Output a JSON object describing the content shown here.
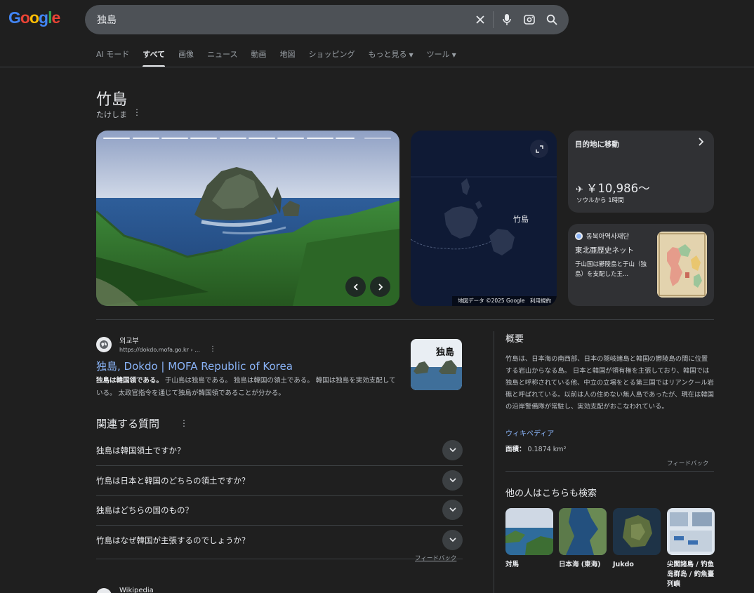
{
  "logo": {
    "text": "Google"
  },
  "search": {
    "query": "独島"
  },
  "tabs": [
    {
      "label": "AI モード"
    },
    {
      "label": "すべて",
      "active": true
    },
    {
      "label": "画像"
    },
    {
      "label": "ニュース"
    },
    {
      "label": "動画"
    },
    {
      "label": "地図"
    },
    {
      "label": "ショッピング"
    },
    {
      "label": "もっと見る",
      "dropdown": true
    },
    {
      "label": "ツール",
      "dropdown": true
    }
  ],
  "entity": {
    "title": "竹島",
    "subtitle": "たけしま"
  },
  "map": {
    "label": "竹島",
    "attribution": "地図データ ©2025 Google　利用規約"
  },
  "destination": {
    "title": "目的地に移動",
    "price": "￥10,986〜",
    "from": "ソウルから 1時間"
  },
  "source_card": {
    "name": "동북아역사재단",
    "title": "東北亜歴史ネット",
    "snippet": "于山国は鬱陵島と于山（独島）を支配した王..."
  },
  "result": {
    "site": "외교부",
    "url": "https://dokdo.mofa.go.kr › ...",
    "title": "独島, Dokdo | MOFA Republic of Korea",
    "snippet_bold": "独島は韓国領である。",
    "snippet": " 于山島は独島である。 独島は韓国の領土である。 韓国は独島を実効支配している。 太政官指令を通じて独島が韓国領であることが分かる。",
    "thumb_text": "独島"
  },
  "paa": {
    "title": "関連する質問",
    "questions": [
      "独島は韓国領土ですか？",
      "竹島は日本と韓国のどちらの領土ですか？",
      "独島はどちらの国のもの？",
      "竹島はなぜ韓国が主張するのでしょうか？"
    ],
    "feedback": "フィードバック"
  },
  "bottom_result": {
    "site": "Wikipedia"
  },
  "knowledge": {
    "title": "概要",
    "description": "竹島は、日本海の南西部、日本の隠岐諸島と韓国の鬱陵島の間に位置する岩山からなる島。 日本と韓国が領有権を主張しており、韓国では独島と呼称されている他、中立の立場をとる第三国ではリアンクール岩礁と呼ばれている。以前は人の住めない無人島であったが、現在は韓国の沿岸警備隊が常駐し、実効支配がおこなわれている。",
    "wiki": "ウィキペディア",
    "area_label": "面積：",
    "area_value": "0.1874 km²",
    "feedback": "フィードバック",
    "also_title": "他の人はこちらも検索",
    "also": [
      {
        "label": "対馬"
      },
      {
        "label": "日本海 (東海)"
      },
      {
        "label": "Jukdo"
      },
      {
        "label": "尖閣諸島 / 钓鱼岛群岛 / 釣魚臺列嶼"
      }
    ]
  },
  "colors": {
    "background": "#1f1f1f",
    "link": "#8ab4f8",
    "search_box": "#4d5156"
  }
}
